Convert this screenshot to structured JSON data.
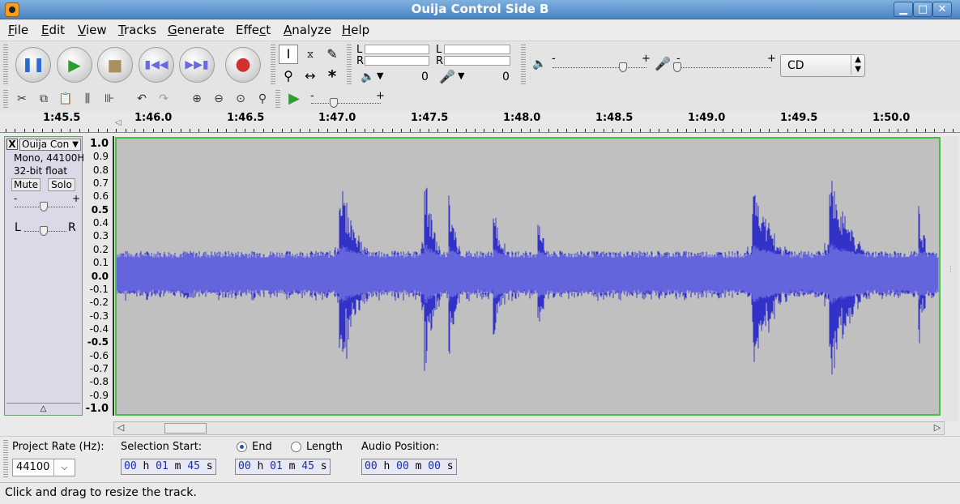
{
  "window": {
    "title": "Ouija Control Side B",
    "btn_min": "▁",
    "btn_max": "□",
    "btn_close": "✕"
  },
  "menu": [
    {
      "key": "F",
      "rest": "ile"
    },
    {
      "key": "E",
      "rest": "dit"
    },
    {
      "key": "V",
      "rest": "iew"
    },
    {
      "key": "T",
      "rest": "racks"
    },
    {
      "key": "G",
      "rest": "enerate"
    },
    {
      "key": "",
      "pre": "Effe",
      "key2": "c",
      "rest": "t"
    },
    {
      "key": "A",
      "rest": "nalyze"
    },
    {
      "key": "H",
      "rest": "elp"
    }
  ],
  "meters": {
    "play_L": "L",
    "play_R": "R",
    "rec_L": "L",
    "rec_R": "R",
    "play_value": "0",
    "rec_value": "0"
  },
  "mixer": {
    "minus": "-",
    "plus": "+"
  },
  "device": {
    "selected": "CD"
  },
  "ruler": {
    "labels": [
      "1:45.5",
      "1:46.0",
      "1:46.5",
      "1:47.0",
      "1:47.5",
      "1:48.0",
      "1:48.5",
      "1:49.0",
      "1:49.5",
      "1:50.0"
    ]
  },
  "track": {
    "name": "Ouija Con",
    "format": "Mono, 44100Hz",
    "bitdepth": "32-bit float",
    "mute": "Mute",
    "solo": "Solo",
    "gain_minus": "-",
    "gain_plus": "+",
    "pan_left": "L",
    "pan_right": "R",
    "close": "X"
  },
  "vruler": [
    "1.0",
    "0.9",
    "0.8",
    "0.7",
    "0.6",
    "0.5",
    "0.4",
    "0.3",
    "0.2",
    "0.1",
    "0.0",
    "-0.1",
    "-0.2",
    "-0.3",
    "-0.4",
    "-0.5",
    "-0.6",
    "-0.7",
    "-0.8",
    "-0.9",
    "-1.0"
  ],
  "selection": {
    "project_rate_label": "Project Rate (Hz):",
    "project_rate": "44100",
    "selection_start_label": "Selection Start:",
    "end_label": "End",
    "length_label": "Length",
    "audio_position_label": "Audio Position:",
    "start_time": {
      "hh": "00",
      "mm": "01",
      "ss": "45"
    },
    "end_time": {
      "hh": "00",
      "mm": "01",
      "ss": "45"
    },
    "audio_time": {
      "hh": "00",
      "mm": "00",
      "ss": "00"
    },
    "unit_h": "h",
    "unit_m": "m",
    "unit_s": "s"
  },
  "status": "Click and drag to resize the track.",
  "colors": {
    "waveform": "#3232c8",
    "waveform_rms": "#6464dc",
    "wave_bg": "#c0c0c0",
    "selected_border": "#43c243",
    "titlebar": "#4a82c3"
  }
}
